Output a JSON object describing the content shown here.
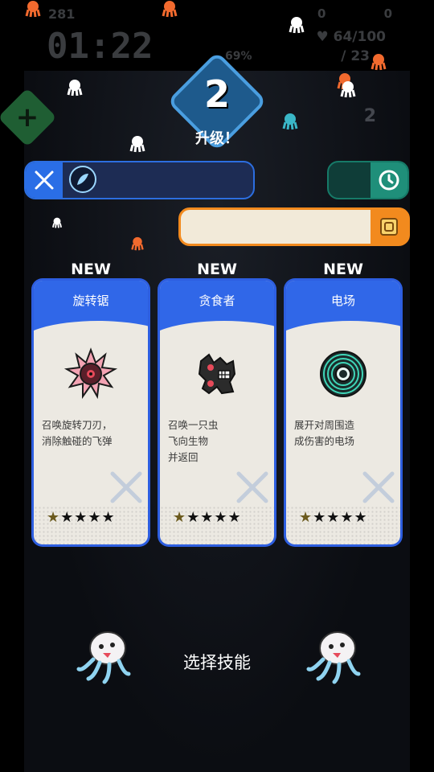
{
  "hud": {
    "kill_count": "281",
    "timer": "01:22",
    "hp": "64/100",
    "ammo": "23",
    "progress_pct": "69%",
    "coin_a": "0",
    "coin_b": "0",
    "slot_number": "2"
  },
  "level": {
    "number": "2",
    "label": "升级！"
  },
  "skill_cards": [
    {
      "badge": "NEW",
      "title": "旋转锯",
      "description": "召唤旋转刀刃，\n消除触碰的飞弹",
      "icon": "spinning-saw-icon",
      "stars_filled": 1,
      "stars_total": 5
    },
    {
      "badge": "NEW",
      "title": "贪食者",
      "description": "召唤一只虫\n飞向生物\n并返回",
      "icon": "devourer-bug-icon",
      "stars_filled": 1,
      "stars_total": 5
    },
    {
      "badge": "NEW",
      "title": "电场",
      "description": "展开对周围造\n成伤害的电场",
      "icon": "electric-field-icon",
      "stars_filled": 1,
      "stars_total": 5
    }
  ],
  "footer": {
    "select_label": "选择技能"
  },
  "colors": {
    "card_blue": "#3067e8",
    "accent_orange": "#f28a1e",
    "accent_teal": "#1f8f7a",
    "add_green": "#1f5e33"
  }
}
